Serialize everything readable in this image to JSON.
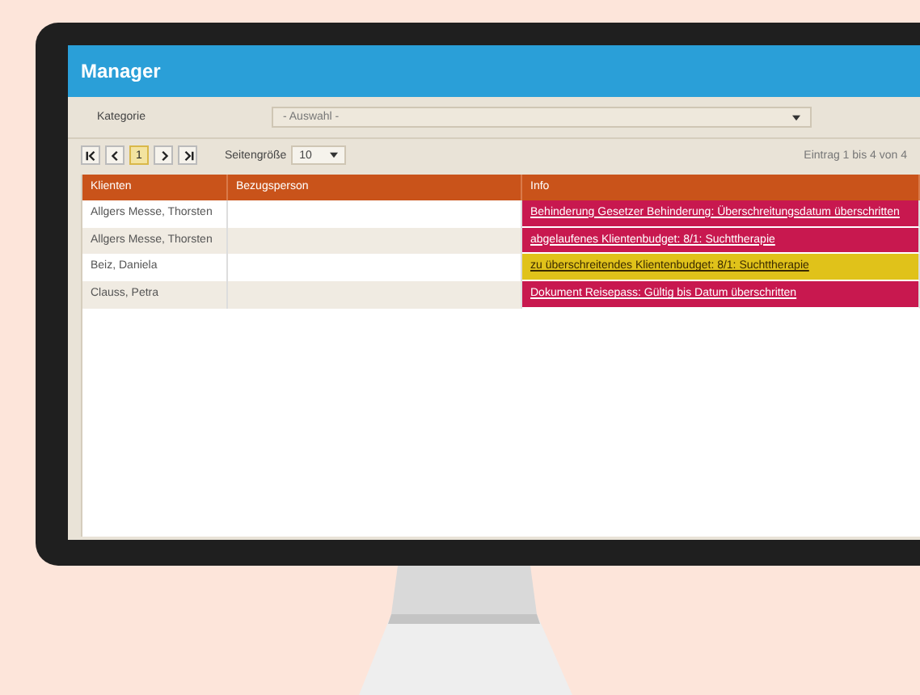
{
  "window": {
    "title": "Manager"
  },
  "filter": {
    "label": "Kategorie",
    "value": "- Auswahl -"
  },
  "pager": {
    "pages": [
      {
        "label": "1",
        "selected": true
      }
    ],
    "page_size_label": "Seitengröße",
    "page_size": "10",
    "summary": "Eintrag 1 bis 4 von 4"
  },
  "table": {
    "columns": [
      "Klienten",
      "Bezugsperson",
      "Info"
    ],
    "rows": [
      {
        "client": "Allgers Messe, Thorsten",
        "info": "Behinderung Gesetzer Behinderung: Überschreitungsdatum überschritten",
        "color": "#c8184f"
      },
      {
        "client": "Allgers Messe, Thorsten",
        "info": "abgelaufenes Klientenbudget: 8/1: Suchttherapie",
        "color": "#c8184f"
      },
      {
        "client": "Beiz, Daniela",
        "info": "zu überschreitendes Klientenbudget: 8/1: Suchttherapie",
        "color": "#e0c21a"
      },
      {
        "client": "Clauss, Petra",
        "info": "Dokument Reisepass: Gültig bis Datum überschritten",
        "color": "#c8184f"
      }
    ]
  }
}
